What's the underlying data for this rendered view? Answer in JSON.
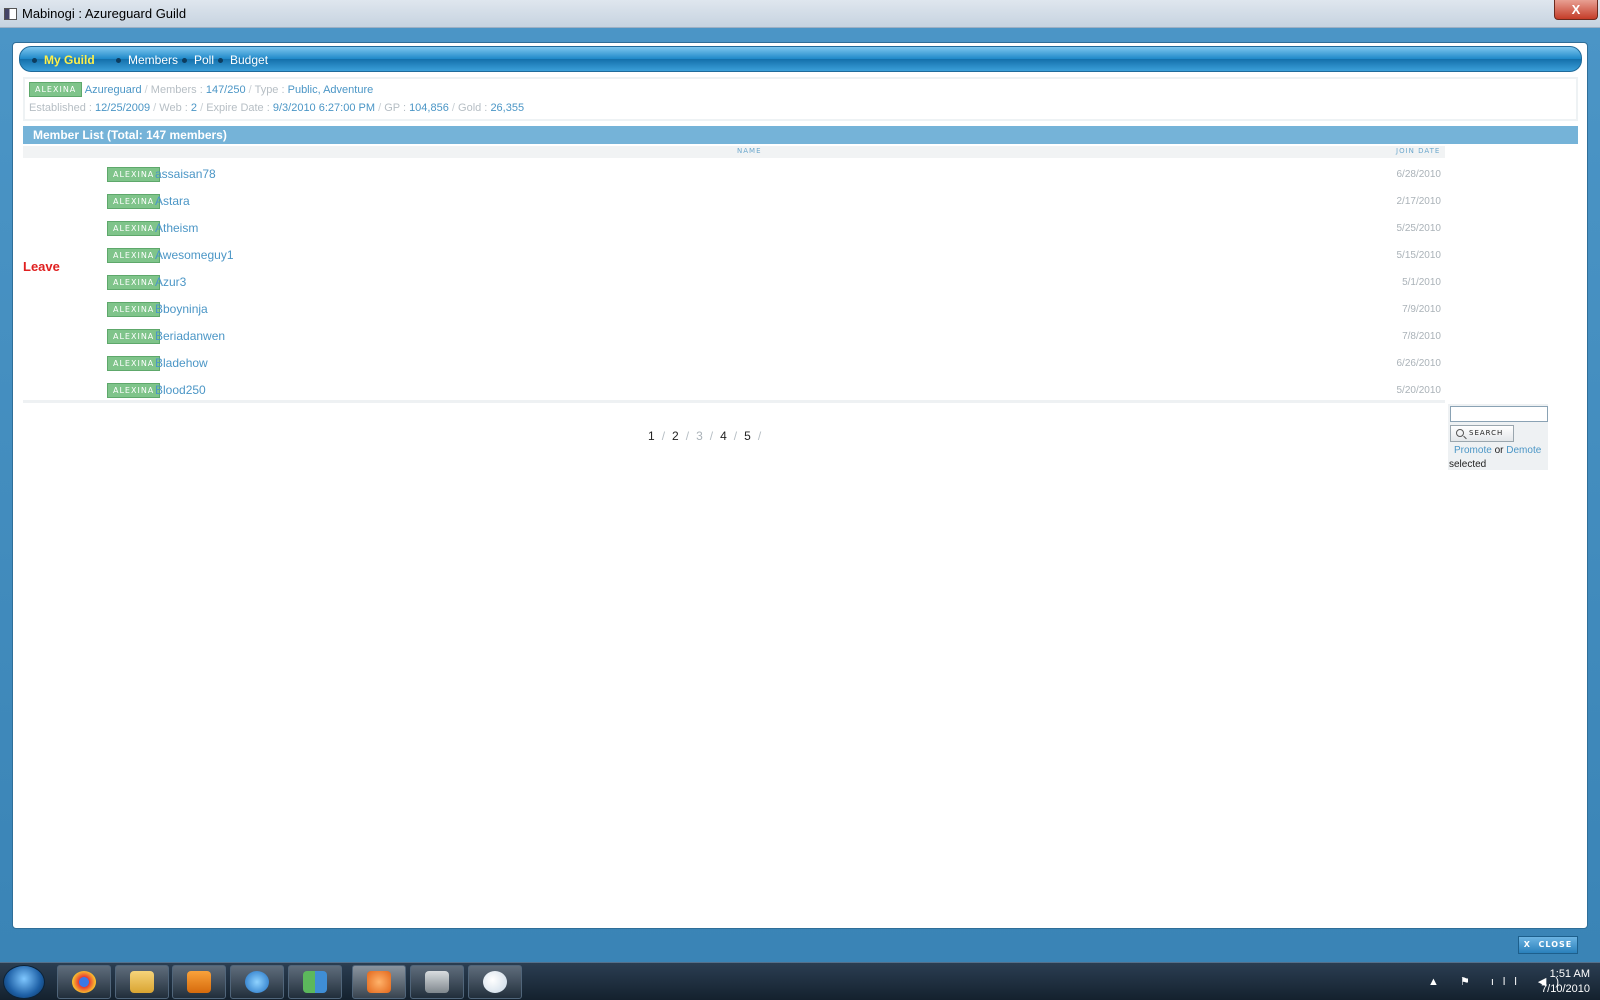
{
  "window": {
    "title": "Mabinogi : Azureguard Guild",
    "close_glyph": "X"
  },
  "nav": {
    "items": [
      {
        "label": "My Guild",
        "active": true
      },
      {
        "label": "Members",
        "active": false
      },
      {
        "label": "Poll",
        "active": false
      },
      {
        "label": "Budget",
        "active": false
      }
    ]
  },
  "guild": {
    "server_badge": "ALEXINA",
    "name": "Azureguard",
    "members_label": "Members :",
    "members_value": "147/250",
    "type_label": "Type :",
    "type_value": "Public, Adventure",
    "established_label": "Established :",
    "established_value": "12/25/2009",
    "web_label": "Web :",
    "web_value": "2",
    "expire_label": "Expire Date :",
    "expire_value": "9/3/2010 6:27:00 PM",
    "gp_label": "GP :",
    "gp_value": "104,856",
    "gold_label": "Gold :",
    "gold_value": "26,355",
    "separator": "/"
  },
  "member_list": {
    "header": "Member List (Total: 147 members)",
    "col_name": "NAME",
    "col_join": "JOIN DATE",
    "leave_label": "Leave",
    "rows": [
      {
        "badge": "ALEXINA",
        "name": "assaisan78",
        "date": "6/28/2010"
      },
      {
        "badge": "ALEXINA",
        "name": "Astara",
        "date": "2/17/2010"
      },
      {
        "badge": "ALEXINA",
        "name": "Atheism",
        "date": "5/25/2010"
      },
      {
        "badge": "ALEXINA",
        "name": "Awesomeguy1",
        "date": "5/15/2010"
      },
      {
        "badge": "ALEXINA",
        "name": "Azur3",
        "date": "5/1/2010"
      },
      {
        "badge": "ALEXINA",
        "name": "Bboyninja",
        "date": "7/9/2010"
      },
      {
        "badge": "ALEXINA",
        "name": "Beriadanwen",
        "date": "7/8/2010"
      },
      {
        "badge": "ALEXINA",
        "name": "Bladehow",
        "date": "6/26/2010"
      },
      {
        "badge": "ALEXINA",
        "name": "Blood250",
        "date": "5/20/2010"
      }
    ]
  },
  "pagination": {
    "pages": [
      "1",
      "2",
      "3",
      "4",
      "5"
    ],
    "current": "3",
    "separator": "/"
  },
  "search": {
    "input_value": "",
    "button_label": "SEARCH",
    "promote_label": "Promote",
    "or_label": "or",
    "demote_label": "Demote",
    "selected_label": "selected"
  },
  "footer": {
    "close_label": "CLOSE",
    "close_x": "X"
  },
  "taskbar": {
    "time": "1:51 AM",
    "date": "7/10/2010",
    "tray_icons": "▲ ⚑ ıll ◀)"
  }
}
